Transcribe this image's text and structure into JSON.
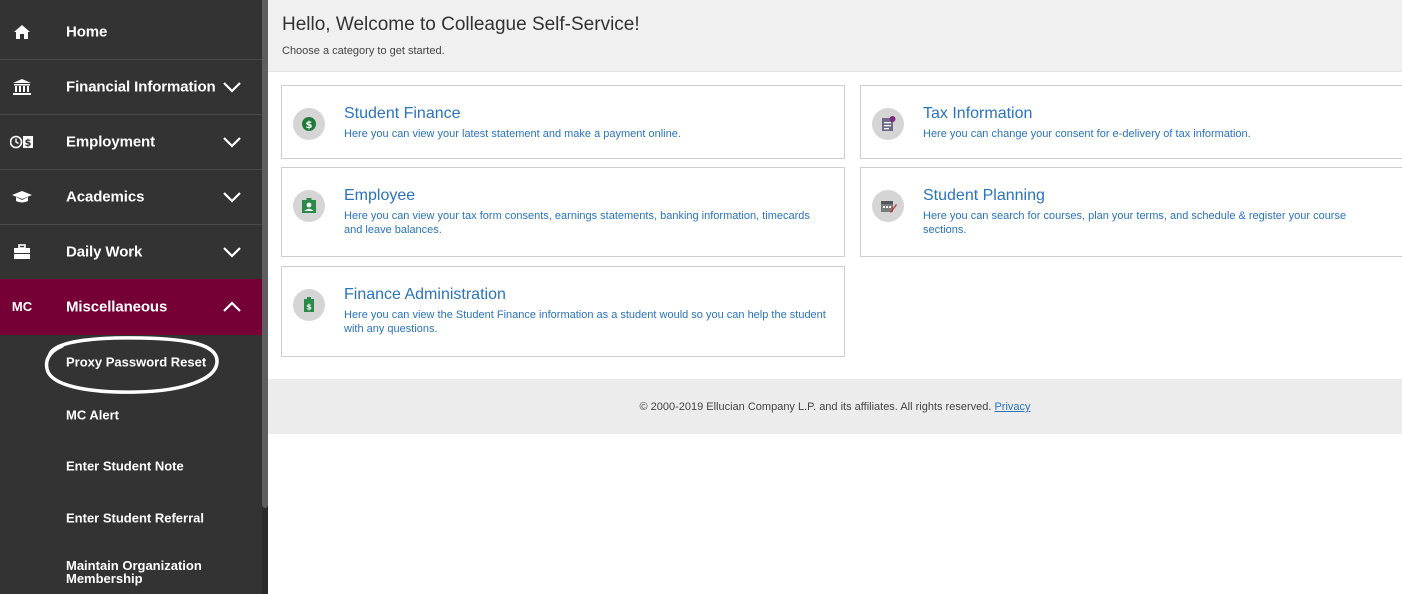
{
  "sidebar": {
    "items": [
      {
        "icon": "home-icon",
        "label": "Home",
        "has_chevron": false
      },
      {
        "icon": "bank-icon",
        "label": "Financial Information",
        "has_chevron": true
      },
      {
        "icon": "employment-icon",
        "label": "Employment",
        "has_chevron": true
      },
      {
        "icon": "graduation-cap-icon",
        "label": "Academics",
        "has_chevron": true
      },
      {
        "icon": "briefcase-icon",
        "label": "Daily Work",
        "has_chevron": true
      },
      {
        "icon_text": "MC",
        "label": "Miscellaneous",
        "has_chevron": true,
        "expanded": true
      }
    ],
    "subitems": [
      {
        "label": "Proxy Password Reset"
      },
      {
        "label": "MC Alert"
      },
      {
        "label": "Enter Student Note"
      },
      {
        "label": "Enter Student Referral"
      },
      {
        "label": "Maintain Organization Membership"
      }
    ],
    "active_color": "#750035"
  },
  "welcome": {
    "title": "Hello, Welcome to Colleague Self-Service!",
    "subtitle": "Choose a category to get started."
  },
  "cards": [
    {
      "icon": "dollar-icon",
      "title": "Student Finance",
      "desc": "Here you can view your latest statement and make a payment online."
    },
    {
      "icon": "tax-document-icon",
      "title": "Tax Information",
      "desc": "Here you can change your consent for e-delivery of tax information."
    },
    {
      "icon": "employee-badge-icon",
      "title": "Employee",
      "desc": "Here you can view your tax form consents, earnings statements, banking information, timecards and leave balances."
    },
    {
      "icon": "calendar-planning-icon",
      "title": "Student Planning",
      "desc": "Here you can search for courses, plan your terms, and schedule & register your course sections."
    },
    {
      "icon": "finance-admin-icon",
      "title": "Finance Administration",
      "desc": "Here you can view the Student Finance information as a student would so you can help the student with any questions."
    }
  ],
  "footer": {
    "text": "© 2000-2019 Ellucian Company L.P. and its affiliates. All rights reserved. ",
    "privacy_link": "Privacy"
  },
  "colors": {
    "link": "#2a73bd",
    "sidebar_bg": "#333333",
    "accent": "#750035"
  }
}
